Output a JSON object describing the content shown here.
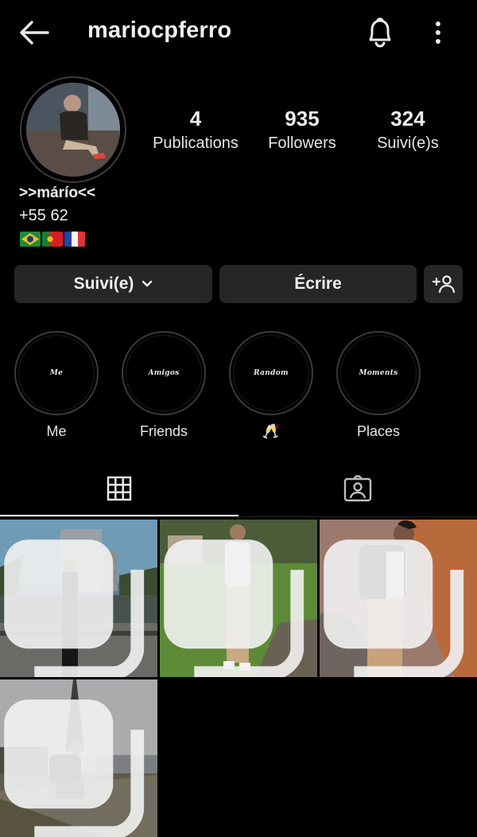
{
  "header": {
    "username": "mariocpferro",
    "icons": [
      "back-arrow-icon",
      "bell-icon",
      "more-vertical-icon"
    ]
  },
  "profile": {
    "stats": [
      {
        "value": "4",
        "label": "Publications"
      },
      {
        "value": "935",
        "label": "Followers"
      },
      {
        "value": "324",
        "label": "Suivi(e)s"
      }
    ],
    "display_name": ">>márío<<",
    "bio_line": "+55 62",
    "flags": [
      "🇧🇷",
      "🇵🇹",
      "🇫🇷"
    ]
  },
  "actions": {
    "follow_label": "Suivi(e)",
    "message_label": "Écrire",
    "add_user_icon": "add-user-icon"
  },
  "highlights": [
    {
      "cover": "Me",
      "label": "Me"
    },
    {
      "cover": "Amigos",
      "label": "Friends"
    },
    {
      "cover": "Random",
      "label": "🥂"
    },
    {
      "cover": "Moments",
      "label": "Places"
    }
  ],
  "tabs": [
    "grid-icon",
    "tagged-icon"
  ],
  "posts": [
    {
      "thumb": "city-balcony-photo",
      "multiple": true
    },
    {
      "thumb": "park-standing-photo",
      "multiple": true
    },
    {
      "thumb": "orange-wall-photo",
      "multiple": true
    },
    {
      "thumb": "eiffel-tower-photo",
      "multiple": true
    }
  ],
  "colors": {
    "background": "#000000",
    "button": "#262626",
    "text": "#efefef"
  }
}
